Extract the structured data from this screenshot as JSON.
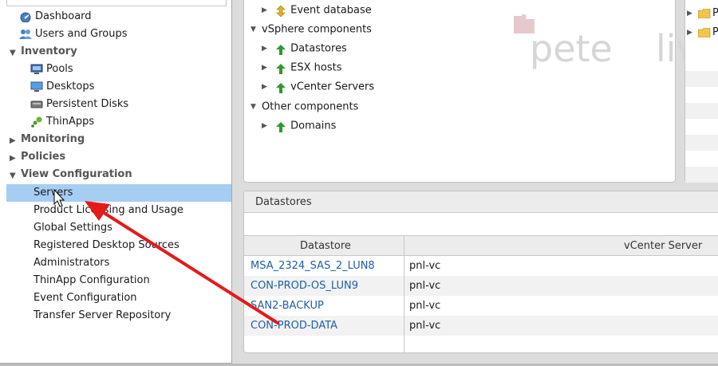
{
  "left_nav": {
    "items": [
      {
        "label": "Dashboard",
        "icon": "dashboard-icon"
      },
      {
        "label": "Users and Groups",
        "icon": "users-icon"
      }
    ],
    "inventory": {
      "label": "Inventory",
      "items": [
        {
          "label": "Pools",
          "icon": "pools-icon"
        },
        {
          "label": "Desktops",
          "icon": "desktops-icon"
        },
        {
          "label": "Persistent Disks",
          "icon": "disk-icon"
        },
        {
          "label": "ThinApps",
          "icon": "thinapps-icon"
        }
      ]
    },
    "monitoring": {
      "label": "Monitoring"
    },
    "policies": {
      "label": "Policies"
    },
    "view_configuration": {
      "label": "View Configuration",
      "items": [
        {
          "label": "Servers",
          "selected": true
        },
        {
          "label": "Product Licensing and Usage"
        },
        {
          "label": "Global Settings"
        },
        {
          "label": "Registered Desktop Sources"
        },
        {
          "label": "Administrators"
        },
        {
          "label": "ThinApp Configuration"
        },
        {
          "label": "Event Configuration"
        },
        {
          "label": "Transfer Server Repository"
        }
      ]
    }
  },
  "tree": {
    "event_database": "Event database",
    "vsphere_components": "vSphere components",
    "datastores": "Datastores",
    "esx_hosts": "ESX hosts",
    "vcenter_servers": "vCenter Servers",
    "other_components": "Other components",
    "domains": "Domains"
  },
  "watermark": {
    "text1": "pete",
    "text2": "live"
  },
  "datastores_panel": {
    "title": "Datastores",
    "columns": [
      "Datastore",
      "vCenter Server"
    ],
    "rows": [
      {
        "datastore": "MSA_2324_SAS_2_LUN8",
        "vcenter": "pnl-vc"
      },
      {
        "datastore": "CON-PROD-OS_LUN9",
        "vcenter": "pnl-vc"
      },
      {
        "datastore": "SAN2-BACKUP",
        "vcenter": "pnl-vc"
      },
      {
        "datastore": "CON-PROD-DATA",
        "vcenter": "pnl-vc"
      }
    ]
  },
  "right_panel": {
    "items": [
      "P",
      "P"
    ]
  },
  "colors": {
    "accent_selected": "#a6cdf2",
    "link": "#1f5fa8",
    "arrow": "#e31b1b",
    "status_up": "#2e9a2e"
  }
}
